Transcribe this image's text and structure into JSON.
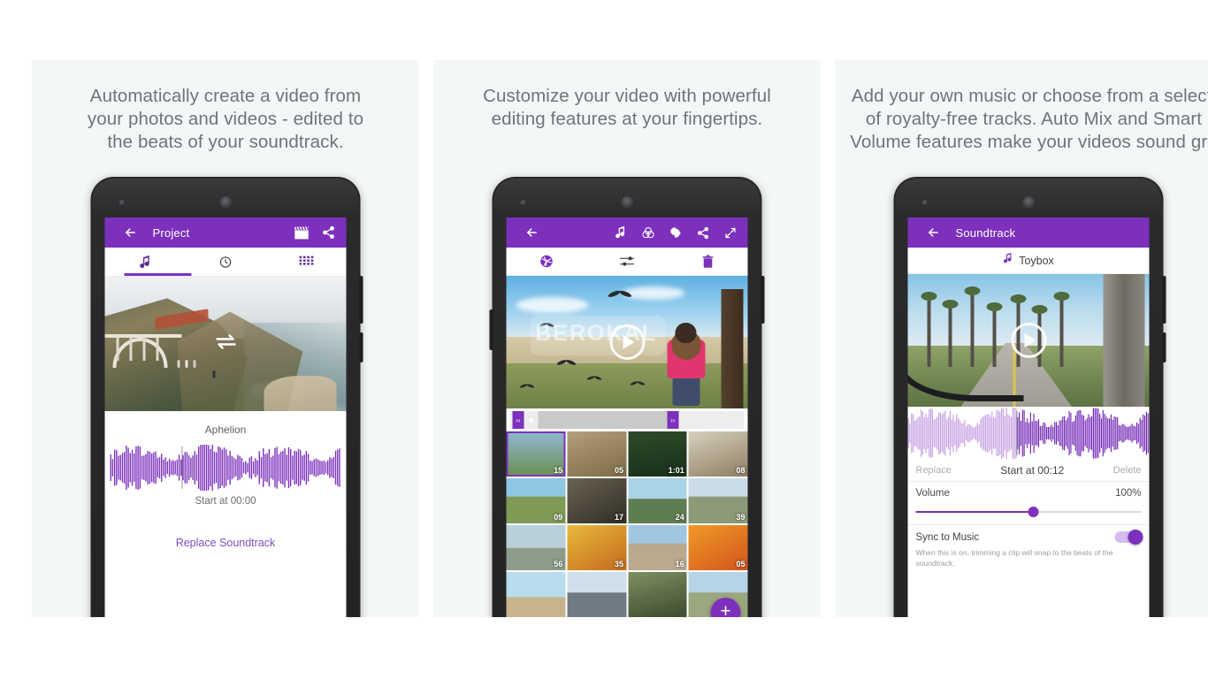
{
  "theme": {
    "accent": "#7C30BC",
    "panel_bg": "#F4F7F7",
    "page_bg": "#FFFFFF",
    "caption_color": "#6F7478"
  },
  "panels": [
    {
      "caption": "Automatically create a video from\nyour photos and videos - edited to\nthe beats of your soundtrack.",
      "appbar": {
        "title": "Project",
        "back_icon": "arrow-left-icon",
        "actions": [
          "clapperboard-icon",
          "share-icon"
        ]
      },
      "tabs": [
        {
          "name": "music",
          "icon": "music-note-icon",
          "active": true
        },
        {
          "name": "duration",
          "icon": "clock-icon",
          "active": false
        },
        {
          "name": "media-grid",
          "icon": "grid-icon",
          "active": false
        }
      ],
      "preview": {
        "overlay_icon": "loop-icon"
      },
      "soundtrack": {
        "title": "Aphelion",
        "start_label": "Start at 00:00",
        "replace_label": "Replace Soundtrack"
      }
    },
    {
      "caption": "Customize your video with powerful\nediting features at your fingertips.",
      "appbar": {
        "back_icon": "arrow-left-icon",
        "actions": [
          "music-note-icon",
          "color-filter-icon",
          "gear-icon",
          "share-icon",
          "expand-icon"
        ]
      },
      "tools": [
        "aperture-icon",
        "adjust-sliders-icon",
        "trash-icon"
      ],
      "preview": {
        "watermark": "BEROKAL",
        "play_icon": "play-icon"
      },
      "trimmer": {
        "left_handle": "trim-handle-left",
        "right_handle": "trim-handle-right"
      },
      "clips": [
        {
          "duration": "15",
          "selected": true
        },
        {
          "duration": "05",
          "selected": false
        },
        {
          "duration": "1:01",
          "selected": false
        },
        {
          "duration": "08",
          "selected": false
        },
        {
          "duration": "09",
          "selected": false
        },
        {
          "duration": "17",
          "selected": false
        },
        {
          "duration": "24",
          "selected": false
        },
        {
          "duration": "39",
          "selected": false
        },
        {
          "duration": "56",
          "selected": false
        },
        {
          "duration": "35",
          "selected": false
        },
        {
          "duration": "16",
          "selected": false
        },
        {
          "duration": "05",
          "selected": false
        },
        {
          "duration": "",
          "selected": false
        },
        {
          "duration": "",
          "selected": false
        },
        {
          "duration": "",
          "selected": false
        },
        {
          "duration": "",
          "selected": false
        }
      ],
      "fab_label": "+"
    },
    {
      "caption": "Add your own music or choose from a selecti\nof royalty-free tracks. Auto Mix and Smart\nVolume features make your videos sound gre",
      "appbar": {
        "title": "Soundtrack",
        "back_icon": "arrow-left-icon"
      },
      "track": {
        "icon": "music-note-icon",
        "name": "Toybox"
      },
      "preview": {
        "play_icon": "play-icon"
      },
      "actions": {
        "replace": "Replace",
        "start": "Start at 00:12",
        "delete": "Delete"
      },
      "volume": {
        "label": "Volume",
        "value": "100%",
        "percent": 52
      },
      "sync": {
        "label": "Sync to Music",
        "state": "on",
        "help": "When this is on, trimming a clip will snap to the beats of the soundtrack."
      }
    }
  ]
}
